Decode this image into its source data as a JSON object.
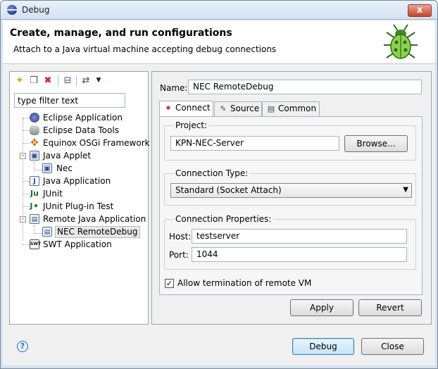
{
  "window": {
    "title": "Debug",
    "close_label": "x"
  },
  "header": {
    "title": "Create, manage, and run configurations",
    "message": "Attach to a Java virtual machine accepting debug connections"
  },
  "left": {
    "filter_placeholder": "type filter text",
    "tree": [
      {
        "label": "Eclipse Application",
        "icon": "eclipse-icon"
      },
      {
        "label": "Eclipse Data Tools",
        "icon": "database-icon"
      },
      {
        "label": "Equinox OSGi Framework",
        "icon": "osgi-icon"
      },
      {
        "label": "Java Applet",
        "icon": "applet-icon"
      },
      {
        "label": "Nec",
        "icon": "applet-config-icon"
      },
      {
        "label": "Java Application",
        "icon": "java-app-icon"
      },
      {
        "label": "JUnit",
        "icon": "junit-icon"
      },
      {
        "label": "JUnit Plug-in Test",
        "icon": "junit-plugin-icon"
      },
      {
        "label": "Remote Java Application",
        "icon": "remote-icon"
      },
      {
        "label": "NEC RemoteDebug",
        "icon": "remote-config-icon"
      },
      {
        "label": "SWT Application",
        "icon": "swt-icon"
      }
    ]
  },
  "right": {
    "name_label": "Name:",
    "name_value": "NEC RemoteDebug",
    "tabs": [
      {
        "label": "Connect"
      },
      {
        "label": "Source"
      },
      {
        "label": "Common"
      }
    ],
    "project": {
      "label": "Project:",
      "value": "KPN-NEC-Server",
      "browse_label": "Browse..."
    },
    "connection_type": {
      "label": "Connection Type:",
      "selected": "Standard (Socket Attach)"
    },
    "connection_properties": {
      "label": "Connection Properties:",
      "host_label": "Host:",
      "host_value": "testserver",
      "port_label": "Port:",
      "port_value": "1044"
    },
    "allow_termination": {
      "label": "Allow termination of remote VM",
      "checked": true
    },
    "apply_label": "Apply",
    "revert_label": "Revert"
  },
  "footer": {
    "debug_label": "Debug",
    "close_label": "Close"
  }
}
